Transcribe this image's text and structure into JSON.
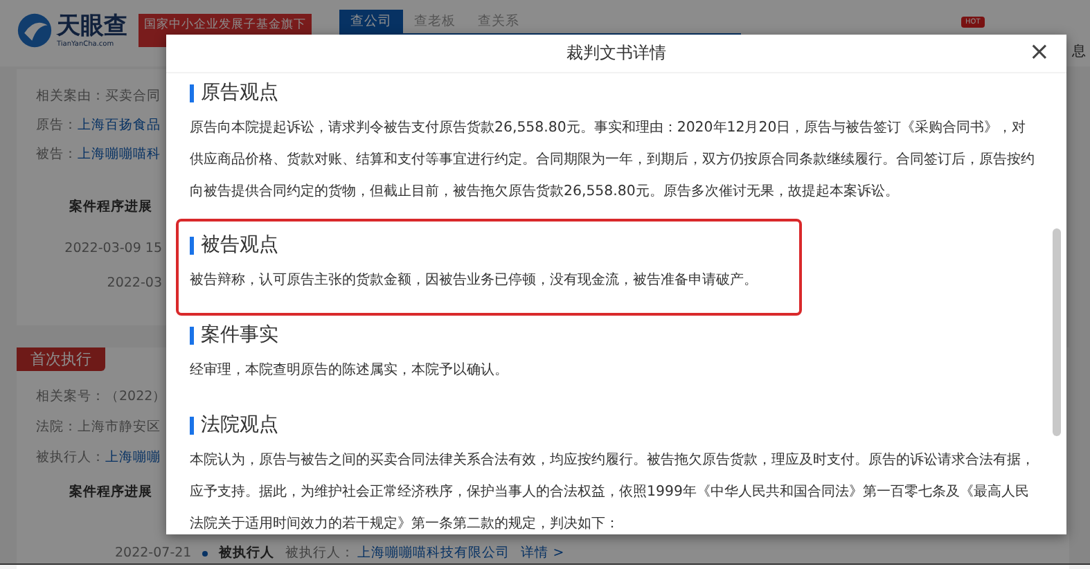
{
  "header": {
    "logo": {
      "name": "天眼查",
      "domain": "TianYanCha.com"
    },
    "banner": "国家中小企业发展子基金旗下",
    "tabs": [
      {
        "label": "查公司",
        "selected": true
      },
      {
        "label": "查老板",
        "selected": false
      },
      {
        "label": "查关系",
        "selected": false
      }
    ],
    "hot_badge": "HOT",
    "menu_item": "息"
  },
  "case_card": {
    "fields": [
      {
        "label": "相关案由：",
        "value": "买卖合同",
        "link": false
      },
      {
        "label": "原告：",
        "value": "上海百扬食品",
        "link": true
      },
      {
        "label": "被告：",
        "value": "上海嘣嘣喵科",
        "link": true
      }
    ],
    "progress_title": "案件程序进展",
    "progress_dates": [
      "2022-03-09 15",
      "2022-03"
    ]
  },
  "execution_card": {
    "tag": "首次执行",
    "fields": [
      {
        "label": "相关案号：",
        "value": "（2022）",
        "link": false
      },
      {
        "label": "法院：",
        "value": "上海市静安区",
        "link": false
      },
      {
        "label": "被执行人：",
        "value": "上海嘣嘣",
        "link": true
      }
    ],
    "progress_title": "案件程序进展",
    "entry": {
      "date": "2022-07-21",
      "role": "被执行人",
      "label": "被执行人：",
      "company": "上海嘣嘣喵科技有限公司",
      "detail": "详情 >"
    }
  },
  "dialog": {
    "title": "裁判文书详情",
    "close": "×",
    "sections": [
      {
        "heading": "原告观点",
        "highlighted": false,
        "text": "原告向本院提起诉讼，请求判令被告支付原告货款26,558.80元。事实和理由：2020年12月20日，原告与被告签订《采购合同书》，对供应商品价格、货款对账、结算和支付等事宜进行约定。合同期限为一年，到期后，双方仍按原合同条款继续履行。合同签订后，原告按约向被告提供合同约定的货物，但截止目前，被告拖欠原告货款26,558.80元。原告多次催讨无果，故提起本案诉讼。"
      },
      {
        "heading": "被告观点",
        "highlighted": true,
        "text": "被告辩称，认可原告主张的货款金额，因被告业务已停顿，没有现金流，被告准备申请破产。"
      },
      {
        "heading": "案件事实",
        "highlighted": false,
        "text": "经审理，本院查明原告的陈述属实，本院予以确认。"
      },
      {
        "heading": "法院观点",
        "highlighted": false,
        "text": "本院认为，原告与被告之间的买卖合同法律关系合法有效，均应按约履行。被告拖欠原告货款，理应及时支付。原告的诉讼请求合法有据，应予支持。据此，为维护社会正常经济秩序，保护当事人的合法权益，依照1999年《中华人民共和国合同法》第一百零七条及《最高人民法院关于适用时间效力的若干规定》第一条第二款的规定，判决如下："
      }
    ]
  }
}
